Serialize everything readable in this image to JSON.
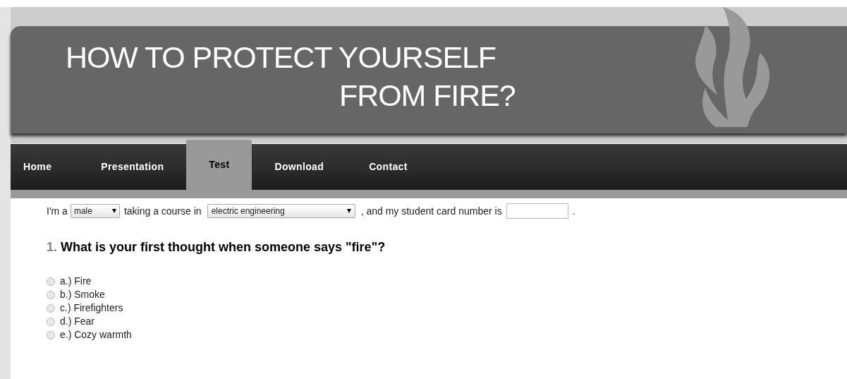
{
  "header": {
    "title_line_1": "HOW TO PROTECT YOURSELF",
    "title_line_2": "FROM FIRE?"
  },
  "nav": [
    {
      "label": "Home",
      "selected": false
    },
    {
      "label": "Presentation",
      "selected": false
    },
    {
      "label": "Test",
      "selected": true
    },
    {
      "label": "Download",
      "selected": false
    },
    {
      "label": "Contact",
      "selected": false
    }
  ],
  "intro": {
    "text_1": "I'm a",
    "gender": "male",
    "text_2": "taking a course in",
    "course": "electric engineering",
    "text_3": ", and my student card number is",
    "text_4": "."
  },
  "question": {
    "number": "1.",
    "text": "What is your first thought when someone says \"fire\"?",
    "answers": [
      {
        "label": "a.) Fire",
        "selected": false
      },
      {
        "label": "b.) Smoke",
        "selected": false
      },
      {
        "label": "c.) Firefighters",
        "selected": false
      },
      {
        "label": "d.) Fear",
        "selected": false
      },
      {
        "label": "e.) Cozy warmth",
        "selected": false
      }
    ]
  }
}
